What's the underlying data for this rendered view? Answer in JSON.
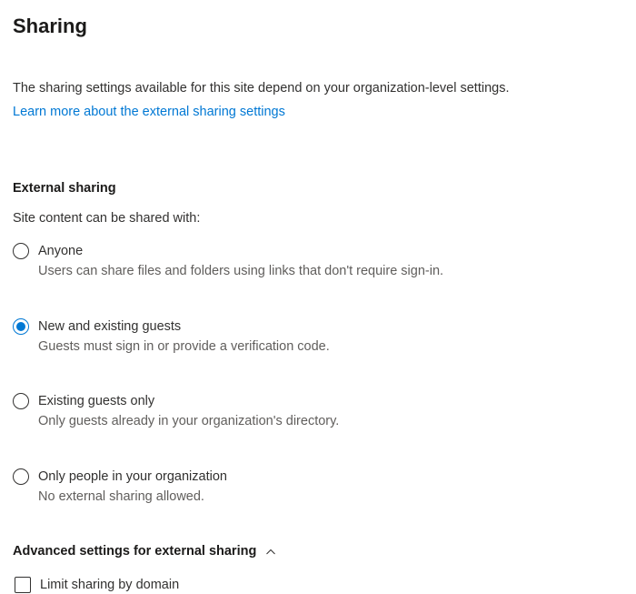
{
  "title": "Sharing",
  "intro": "The sharing settings available for this site depend on your organization-level settings.",
  "learn_link": "Learn more about the external sharing settings",
  "external_sharing": {
    "heading": "External sharing",
    "subtext": "Site content can be shared with:",
    "selected_index": 1,
    "options": [
      {
        "label": "Anyone",
        "description": "Users can share files and folders using links that don't require sign-in."
      },
      {
        "label": "New and existing guests",
        "description": "Guests must sign in or provide a verification code."
      },
      {
        "label": "Existing guests only",
        "description": "Only guests already in your organization's directory."
      },
      {
        "label": "Only people in your organization",
        "description": "No external sharing allowed."
      }
    ]
  },
  "advanced": {
    "heading": "Advanced settings for external sharing",
    "expanded": true,
    "items": [
      {
        "label": "Limit sharing by domain",
        "checked": false
      }
    ]
  }
}
